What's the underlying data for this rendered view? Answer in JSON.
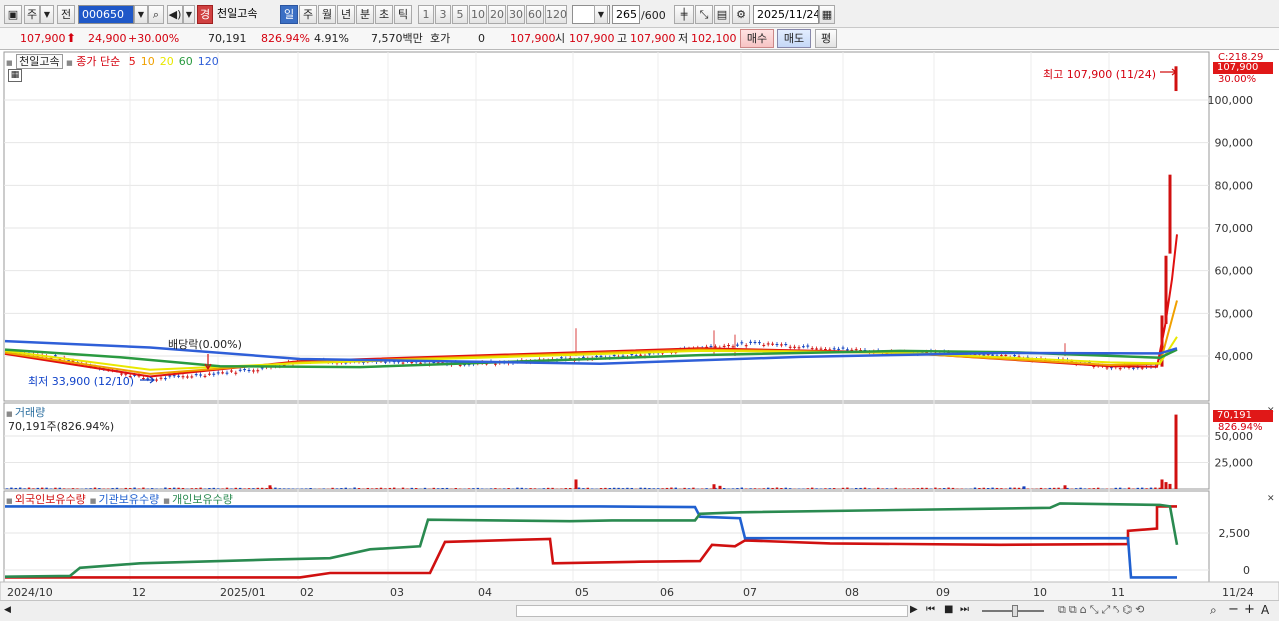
{
  "toolbar": {
    "market_type": "주",
    "prev_label": "전",
    "stock_code": "000650",
    "stock_badge": "경",
    "stock_name": "천일고속",
    "periods": [
      "일",
      "주",
      "월",
      "년",
      "분",
      "초",
      "틱"
    ],
    "active_period": "일",
    "intervals": [
      "1",
      "3",
      "5",
      "10",
      "20",
      "30",
      "60",
      "120"
    ],
    "count_value": "265",
    "count_total": "/600",
    "date": "2025/11/24"
  },
  "quote": {
    "price": "107,900",
    "change": "24,900",
    "change_pct": "+30.00%",
    "volume": "70,191",
    "volume_ratio": "826.94%",
    "turnover_pct": "4.91%",
    "amount": "7,570백만",
    "hoga_label": "호가",
    "hoga_value": "0",
    "hoga_price": "107,900",
    "open_label": "시",
    "open": "107,900",
    "high_label": "고",
    "high": "107,900",
    "low_label": "저",
    "low": "102,100",
    "buy_label": "매수",
    "sell_label": "매도",
    "avg_label": "평"
  },
  "price_pane": {
    "legend_name": "천일고속",
    "legend_ma": "종가 단순",
    "ma_periods": [
      "5",
      "10",
      "20",
      "60",
      "120"
    ],
    "ma_colors": [
      "#e01010",
      "#f0a000",
      "#e8e800",
      "#2a9a40",
      "#2f5fd8"
    ],
    "high_note": "최고 107,900 (11/24)",
    "low_note": "최저 33,900 (12/10)",
    "dividend_note": "배당락(0.00%)",
    "right_top": "C:218.29",
    "current_tag": "107,900",
    "pct_tag": "30.00%",
    "y_ticks": [
      "100,000",
      "90,000",
      "80,000",
      "70,000",
      "60,000",
      "50,000",
      "40,000"
    ]
  },
  "volume_pane": {
    "title": "거래량",
    "value_line": "70,191주(826.94%)",
    "current_tag": "70,191",
    "pct_tag": "826.94%",
    "y_ticks": [
      "50,000",
      "25,000"
    ]
  },
  "holding_pane": {
    "legend": [
      "외국인보유수량",
      "기관보유수량",
      "개인보유수량"
    ],
    "colors": [
      "#d01010",
      "#2060d0",
      "#2a8a50"
    ],
    "y_ticks": [
      "2,500",
      "0"
    ]
  },
  "x_axis": [
    "2024/10",
    "12",
    "2025/01",
    "02",
    "03",
    "04",
    "05",
    "06",
    "07",
    "08",
    "09",
    "10",
    "11",
    "11/24"
  ]
}
